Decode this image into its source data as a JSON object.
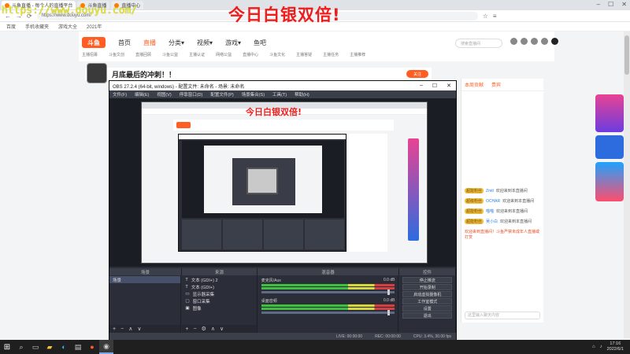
{
  "overlay": {
    "title": "今日白银双倍!",
    "url_watermark": "https://www.douyu.com/"
  },
  "browser": {
    "tabs": [
      {
        "label": "斗鱼直播 - 每个人的直播平台"
      },
      {
        "label": "斗鱼直播"
      },
      {
        "label": "直播中心"
      }
    ],
    "address": "https://www.douyu.com/",
    "bookmarks": [
      "百度",
      "手机收藏夹",
      "游戏大全",
      "2021年"
    ]
  },
  "site": {
    "logo": "斗鱼",
    "nav": [
      "首页",
      "直播",
      "分类▾",
      "视频▾",
      "游戏▾",
      "鱼吧"
    ],
    "active_nav": "直播",
    "search_placeholder": "搜索直播间",
    "subnav": [
      "主播招募",
      "斗鱼文创",
      "直播回顾",
      "斗鱼公益",
      "主播认证",
      "网络公益",
      "直播中心",
      "斗鱼文化",
      "主播答疑",
      "主播任务",
      "主播推荐"
    ]
  },
  "stream": {
    "title": "月底最后的冲刺！！",
    "follow_label": "关注"
  },
  "chat": {
    "tabs": [
      "本周贡献",
      "贵宾"
    ],
    "messages": [
      {
        "badge": "超能粉丝",
        "name": "Zmtl",
        "text": "欢迎来到本直播间"
      },
      {
        "badge": "超级粉丝",
        "name": "OCHAR",
        "text": "欢迎来到本直播间"
      },
      {
        "badge": "超能粉丝",
        "name": "喵喵",
        "text": "欢迎来到本直播间"
      },
      {
        "badge": "超能粉丝",
        "name": "吴小白",
        "text": "欢迎来到本直播间"
      }
    ],
    "notice": "欢迎来到直播间！斗鱼严禁未成年人直播或打赏",
    "input_placeholder": "这里输入聊天内容"
  },
  "obs": {
    "title": "OBS 27.2.4 (64-bit, windows) - 配置文件: 未命名 - 场景: 未命名",
    "menu": [
      "文件(F)",
      "编辑(E)",
      "视图(V)",
      "停靠窗口(D)",
      "配置文件(P)",
      "场景集合(S)",
      "工具(T)",
      "帮助(H)"
    ],
    "docks": [
      "场景",
      "来源",
      "混音器",
      "控件"
    ],
    "scenes": [
      "场景"
    ],
    "sources": [
      "文本 (GDI+) 2",
      "文本 (GDI+)",
      "显示器采集",
      "窗口采集",
      "图像"
    ],
    "mixer": [
      {
        "name": "麦克风/Aux",
        "db": "0.0 dB"
      },
      {
        "name": "桌面音频",
        "db": "0.0 dB"
      }
    ],
    "controls": [
      "停止推流",
      "开始录制",
      "启动虚拟摄像机",
      "工作室模式",
      "设置",
      "退出"
    ],
    "status": [
      "LIVE: 00:00:00",
      "REC: 00:00:00",
      "CPU: 3.4%, 30.00 fps"
    ],
    "active_label": "未选择源"
  },
  "taskbar": {
    "time": "17:16",
    "date": "2022/6/1",
    "icons": [
      "search-icon",
      "task-view-icon",
      "explorer-icon",
      "edge-icon",
      "store-icon",
      "browser-icon",
      "obs-icon"
    ]
  }
}
